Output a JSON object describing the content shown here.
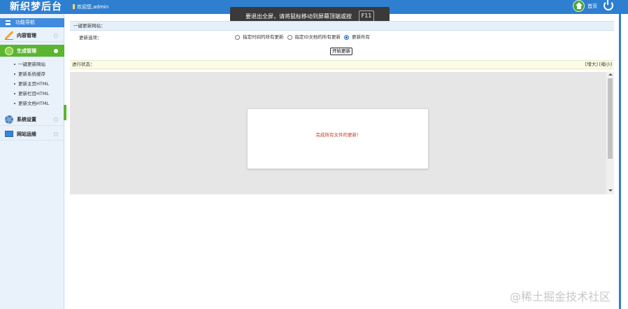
{
  "header": {
    "logo": "新织梦后台",
    "welcome": "欢迎您,admin",
    "home_label": "首页"
  },
  "fullscreen_notice": {
    "message": "要退出全屏，请将鼠标移动到屏幕顶端或按",
    "key": "F11"
  },
  "sidebar": {
    "title": "功能导航",
    "menus": [
      {
        "label": "内容管理",
        "icon": "pencil-icon"
      },
      {
        "label": "生成管理",
        "icon": "tree-icon",
        "active": true
      },
      {
        "label": "系统设置",
        "icon": "gear-icon"
      },
      {
        "label": "网站运维",
        "icon": "monitor-icon"
      }
    ],
    "submenu": [
      "一键更新网站",
      "更新系统缓存",
      "更新主页HTML",
      "更新栏目HTML",
      "更新文档HTML"
    ]
  },
  "main": {
    "panel_title": "一键更新网站：",
    "option_label": "更新选项：",
    "radios": [
      {
        "label": "指定时间的所有更新",
        "checked": false
      },
      {
        "label": "指定ID文档的所有更新",
        "checked": false
      },
      {
        "label": "更新所有",
        "checked": true
      }
    ],
    "start_button": "开始更新",
    "progress_label": "进行状态：",
    "progress_links": "[增大] [缩小]",
    "result_message": "完成所有文件的更新！"
  },
  "watermark": "@稀土掘金技术社区",
  "colors": {
    "header_blue": "#2f7fd1",
    "active_green": "#5cb531",
    "result_red": "#c0392b"
  }
}
